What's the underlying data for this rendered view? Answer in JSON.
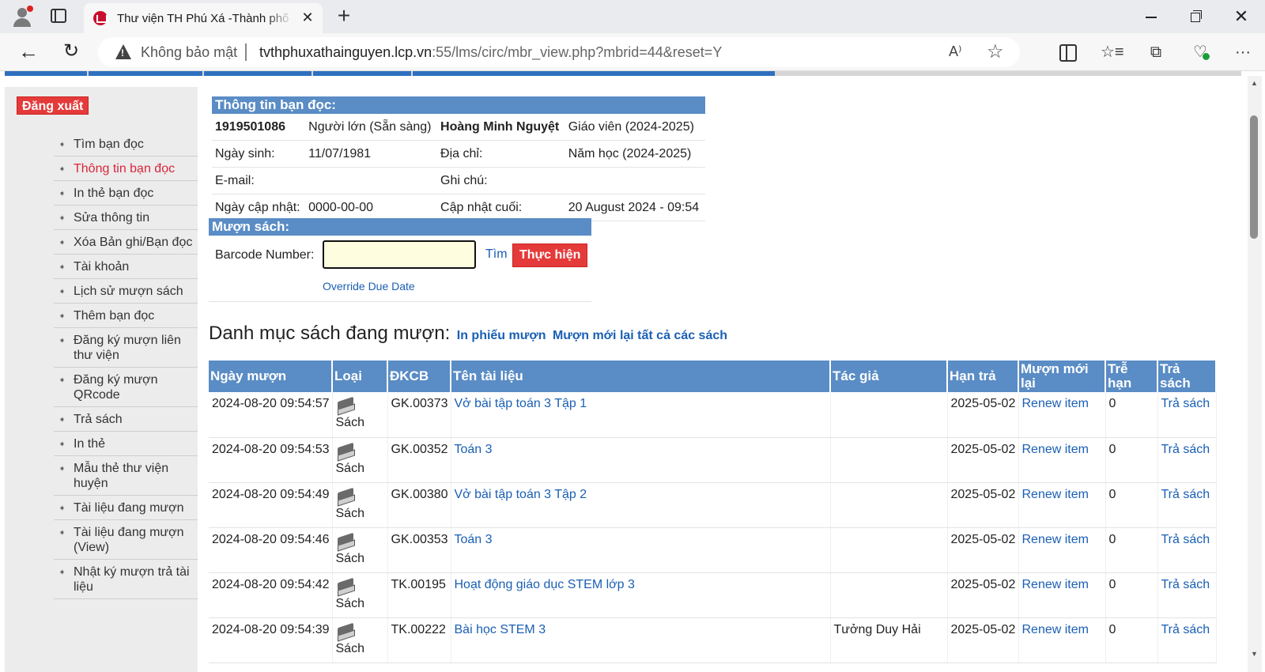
{
  "browser": {
    "tab_title": "Thư viện TH Phú Xá -Thành phố Thái Nguyên",
    "tab_close": "✕",
    "new_tab": "+",
    "not_secure": "Không bảo mật",
    "url_host": "tvthphuxathainguyen.lcp.vn",
    "url_rest": ":55/lms/circ/mbr_view.php?mbrid=44&reset=Y",
    "read_aloud": "A⁾",
    "favorite": "☆",
    "more": "···"
  },
  "sidebar": {
    "logout": "Đăng xuất",
    "items": [
      {
        "label": "Tìm bạn đọc",
        "active": false
      },
      {
        "label": "Thông tin bạn đọc",
        "active": true
      },
      {
        "label": "In thẻ bạn đọc",
        "active": false
      },
      {
        "label": "Sửa thông tin",
        "active": false
      },
      {
        "label": "Xóa Bản ghi/Bạn đọc",
        "active": false
      },
      {
        "label": "Tài khoản",
        "active": false
      },
      {
        "label": "Lịch sử mượn sách",
        "active": false
      },
      {
        "label": "Thêm bạn đọc",
        "active": false
      },
      {
        "label": "Đăng ký mượn liên thư viện",
        "active": false
      },
      {
        "label": "Đăng ký mượn QRcode",
        "active": false
      },
      {
        "label": "Trả sách",
        "active": false
      },
      {
        "label": "In thẻ",
        "active": false
      },
      {
        "label": "Mẫu thẻ thư viện huyện",
        "active": false
      },
      {
        "label": "Tài liệu đang mượn",
        "active": false
      },
      {
        "label": "Tài liệu đang mượn (View)",
        "active": false
      },
      {
        "label": "Nhật ký mượn trả tài liệu",
        "active": false
      }
    ]
  },
  "member": {
    "section_title": "Thông tin bạn đọc:",
    "id": "1919501086",
    "type": "Người lớn (Sẵn sàng)",
    "name": "Hoàng Minh Nguyệt",
    "group": "Giáo viên (2024-2025)",
    "dob_label": "Ngày sinh:",
    "dob": "11/07/1981",
    "address_label": "Địa chỉ:",
    "address": "Năm học (2024-2025)",
    "email_label": "E-mail:",
    "email": "",
    "note_label": "Ghi chú:",
    "note": "",
    "updated_label": "Ngày cập nhật:",
    "updated": "0000-00-00",
    "last_update_label": "Cập nhật cuối:",
    "last_update": "20 August 2024 - 09:54"
  },
  "borrow": {
    "section_title": "Mượn sách:",
    "barcode_label": "Barcode Number:",
    "barcode_value": "",
    "find": "Tìm",
    "execute": "Thực hiện",
    "override": "Override Due Date"
  },
  "loans": {
    "title": "Danh mục sách đang mượn:",
    "print_link": "In phiếu mượn",
    "renew_all_link": "Mượn mới lại tất cả các sách",
    "headers": [
      "Ngày mượn",
      "Loại",
      "ĐKCB",
      "Tên tài liệu",
      "Tác giả",
      "Hạn trả",
      "Mượn mới lại",
      "Trễ hạn",
      "Trả sách"
    ],
    "rows": [
      {
        "date": "2024-08-20 09:54:57",
        "type": "Sách",
        "code": "GK.00373",
        "title": "Vở bài tập toán 3 Tập 1",
        "author": "",
        "due": "2025-05-02",
        "renew": "Renew item",
        "late": "0",
        "return": "Trả sách"
      },
      {
        "date": "2024-08-20 09:54:53",
        "type": "Sách",
        "code": "GK.00352",
        "title": "Toán 3",
        "author": "",
        "due": "2025-05-02",
        "renew": "Renew item",
        "late": "0",
        "return": "Trả sách"
      },
      {
        "date": "2024-08-20 09:54:49",
        "type": "Sách",
        "code": "GK.00380",
        "title": "Vở bài tập toán 3 Tập 2",
        "author": "",
        "due": "2025-05-02",
        "renew": "Renew item",
        "late": "0",
        "return": "Trả sách"
      },
      {
        "date": "2024-08-20 09:54:46",
        "type": "Sách",
        "code": "GK.00353",
        "title": "Toán 3",
        "author": "",
        "due": "2025-05-02",
        "renew": "Renew item",
        "late": "0",
        "return": "Trả sách"
      },
      {
        "date": "2024-08-20 09:54:42",
        "type": "Sách",
        "code": "TK.00195",
        "title": "Hoạt động giáo dục STEM lớp 3",
        "author": "",
        "due": "2025-05-02",
        "renew": "Renew item",
        "late": "0",
        "return": "Trả sách"
      },
      {
        "date": "2024-08-20 09:54:39",
        "type": "Sách",
        "code": "TK.00222",
        "title": "Bài học STEM 3",
        "author": "Tưởng Duy Hải",
        "due": "2025-05-02",
        "renew": "Renew item",
        "late": "0",
        "return": "Trả sách"
      }
    ]
  }
}
